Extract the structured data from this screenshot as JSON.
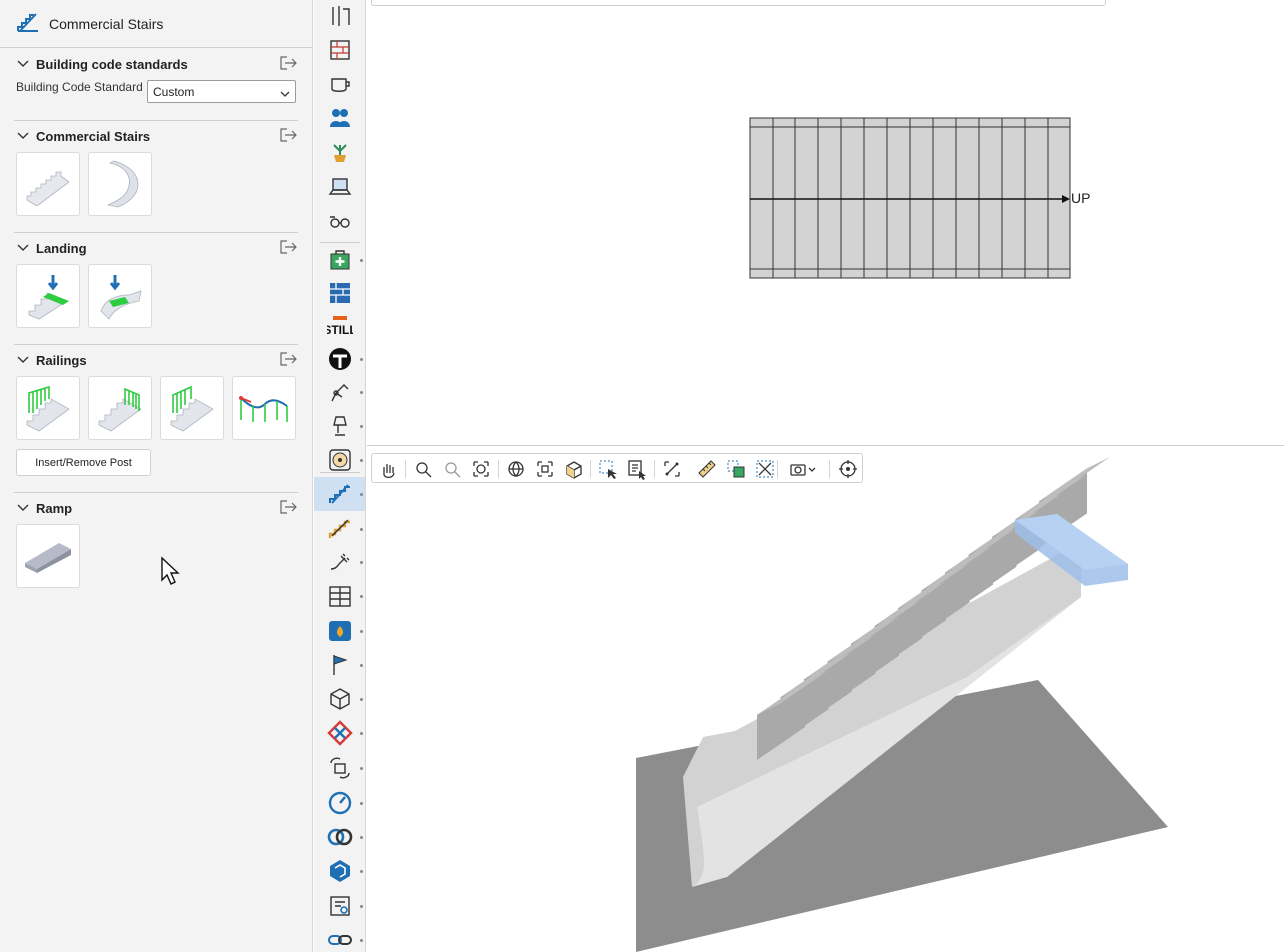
{
  "panel": {
    "title": "Commercial Stairs",
    "sections": {
      "code": {
        "label": "Building code standards",
        "field_label": "Building Code Standard",
        "selected": "Custom"
      },
      "stairs": {
        "label": "Commercial Stairs",
        "items": [
          "straight-stair-icon",
          "spiral-stair-icon"
        ]
      },
      "landing": {
        "label": "Landing",
        "items": [
          "straight-landing-icon",
          "curved-landing-icon"
        ]
      },
      "railings": {
        "label": "Railings",
        "items": [
          "railing-left-icon",
          "railing-right-icon",
          "railing-both-icon",
          "railing-path-icon"
        ],
        "button": "Insert/Remove Post"
      },
      "ramp": {
        "label": "Ramp",
        "items": [
          "ramp-icon"
        ]
      }
    }
  },
  "strip": {
    "icons": [
      "tools-icon",
      "wall-icon",
      "coffee-icon",
      "people-icon",
      "plant-icon",
      "laptop-icon",
      "glasses-icon",
      "medical-icon",
      "brick-icon",
      "still-logo",
      "t-logo",
      "robot-arm-icon",
      "lamp-icon",
      "fan-icon",
      "stairs-icon",
      "stairs-wood-icon",
      "plug-icon",
      "shelving-icon",
      "fireplace-icon",
      "flag-icon",
      "cube-network-icon",
      "puzzle-icon",
      "refresh-device-icon",
      "gauge-icon",
      "rings-icon",
      "sketchup-icon",
      "catalog-icon",
      "chain-icon"
    ],
    "brand_text": "STILL"
  },
  "plan": {
    "direction_label": "UP"
  },
  "toolbar": {
    "icons": [
      "pan-icon",
      "zoom-icon",
      "zoom-window-icon",
      "zoom-extents-icon",
      "globe-icon",
      "fit-selection-icon",
      "iso-view-icon",
      "select-icon",
      "select-text-icon",
      "measure-frame-icon",
      "ruler-icon",
      "copy-select-icon",
      "remove-icon",
      "camera-icon",
      "target-icon"
    ]
  },
  "colors": {
    "accent": "#1f6fb5",
    "active_bg": "#cfe0f2",
    "stair_gray": "#bdbdbd",
    "landing_blue": "#8fb8e8"
  }
}
